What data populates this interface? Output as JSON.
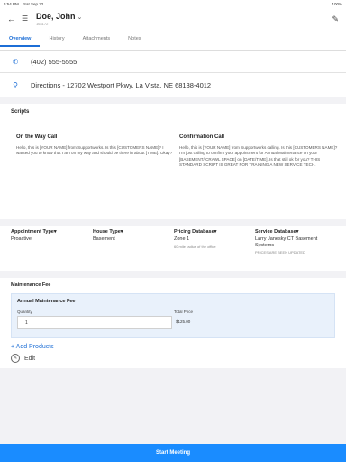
{
  "statusbar": {
    "time": "5:54 PM",
    "date": "Sat Sep 22",
    "battery": "100%"
  },
  "header": {
    "name": "Doe, John",
    "customer_id": "164172"
  },
  "tabs": [
    "Overview",
    "History",
    "Attachments",
    "Notes"
  ],
  "contact": {
    "phone": "(402) 555-5555",
    "directions": "Directions - 12702 Westport Pkwy, La Vista, NE 68138-4012"
  },
  "scripts": {
    "title": "Scripts",
    "on_the_way": {
      "title": "On the Way Call",
      "body": "Hello, this is [YOUR NAME] from Supportworks. Is this [CUSTOMERS NAME]? I wanted you to know that I am on my way and should be there in about [TIME]. Okay?"
    },
    "confirmation": {
      "title": "Confirmation Call",
      "body": "Hello, this is [YOUR NAME] from Supportworks calling. Is this [CUSTOMERS NAME]? I'm just calling to confirm your appointment for Annual Maintenance on your [BASEMENT/ CRAWL SPACE] on [DATE/TIME]. Is that still ok for you? THIS STANDARD SCRIPT IS GREAT FOR TRAINING A NEW SERVICE TECH."
    }
  },
  "fields": {
    "appointment_type": {
      "label": "Appointment Type",
      "value": "Proactive"
    },
    "house_type": {
      "label": "House Type",
      "value": "Basement"
    },
    "pricing_database": {
      "label": "Pricing Database",
      "value": "Zone 1",
      "note": "60 mile radius of the office"
    },
    "service_database": {
      "label": "Service Database",
      "value": "Larry Janesky CT Basement Systems",
      "note": "PRICES ARE BEEN UPDATED"
    }
  },
  "maintenance": {
    "title": "Maintenance Fee",
    "fee_name": "Annual Maintenance Fee",
    "quantity_label": "Quantity",
    "quantity_value": "1",
    "total_label": "Total Price",
    "total_value": "$125.00",
    "add_products": "+ Add Products",
    "edit_label": "Edit"
  },
  "footer": {
    "start_label": "Start Meeting"
  },
  "colors": {
    "accent": "#1c6ed6",
    "button": "#1a8cff"
  }
}
